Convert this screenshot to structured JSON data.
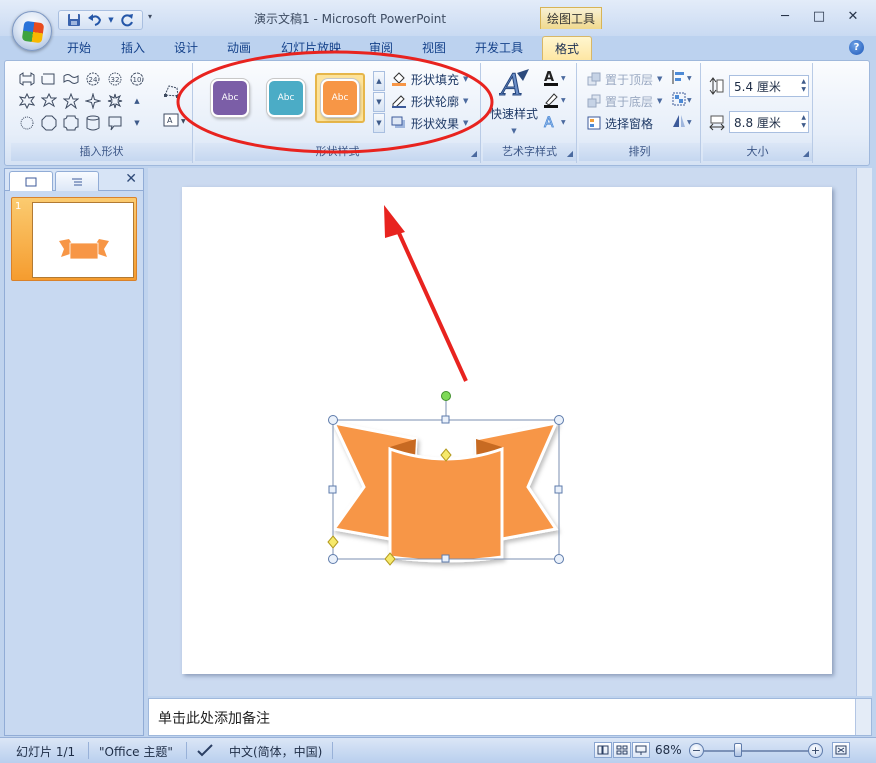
{
  "window": {
    "title": "演示文稿1 - Microsoft PowerPoint",
    "context_tab_group": "绘图工具"
  },
  "tabs": [
    {
      "label": "开始"
    },
    {
      "label": "插入"
    },
    {
      "label": "设计"
    },
    {
      "label": "动画"
    },
    {
      "label": "幻灯片放映"
    },
    {
      "label": "审阅"
    },
    {
      "label": "视图"
    },
    {
      "label": "开发工具"
    },
    {
      "label": "格式",
      "active": true
    }
  ],
  "ribbon": {
    "insert_shapes": {
      "label": "插入形状"
    },
    "shape_styles": {
      "label": "形状样式",
      "gallery": [
        {
          "text": "Abc",
          "color": "#7b5ea7"
        },
        {
          "text": "Abc",
          "color": "#4bacc6"
        },
        {
          "text": "Abc",
          "color": "#f79646"
        }
      ],
      "fill": "形状填充",
      "outline": "形状轮廓",
      "effects": "形状效果"
    },
    "wordart": {
      "label": "艺术字样式",
      "quick_styles": "快速样式"
    },
    "arrange": {
      "label": "排列",
      "bring_front": "置于顶层",
      "send_back": "置于底层",
      "selection_pane": "选择窗格"
    },
    "size": {
      "label": "大小",
      "height": "5.4 厘米",
      "width": "8.8 厘米"
    }
  },
  "slides_pane": {
    "slide_number": "1"
  },
  "notes": {
    "placeholder": "单击此处添加备注"
  },
  "status": {
    "slide": "幻灯片 1/1",
    "theme": "\"Office 主题\"",
    "language": "中文(简体，中国)",
    "zoom": "68%"
  },
  "colors": {
    "shape_fill": "#f79646",
    "annotation": "#e8231f",
    "accent_tab": "#fde5a0"
  }
}
